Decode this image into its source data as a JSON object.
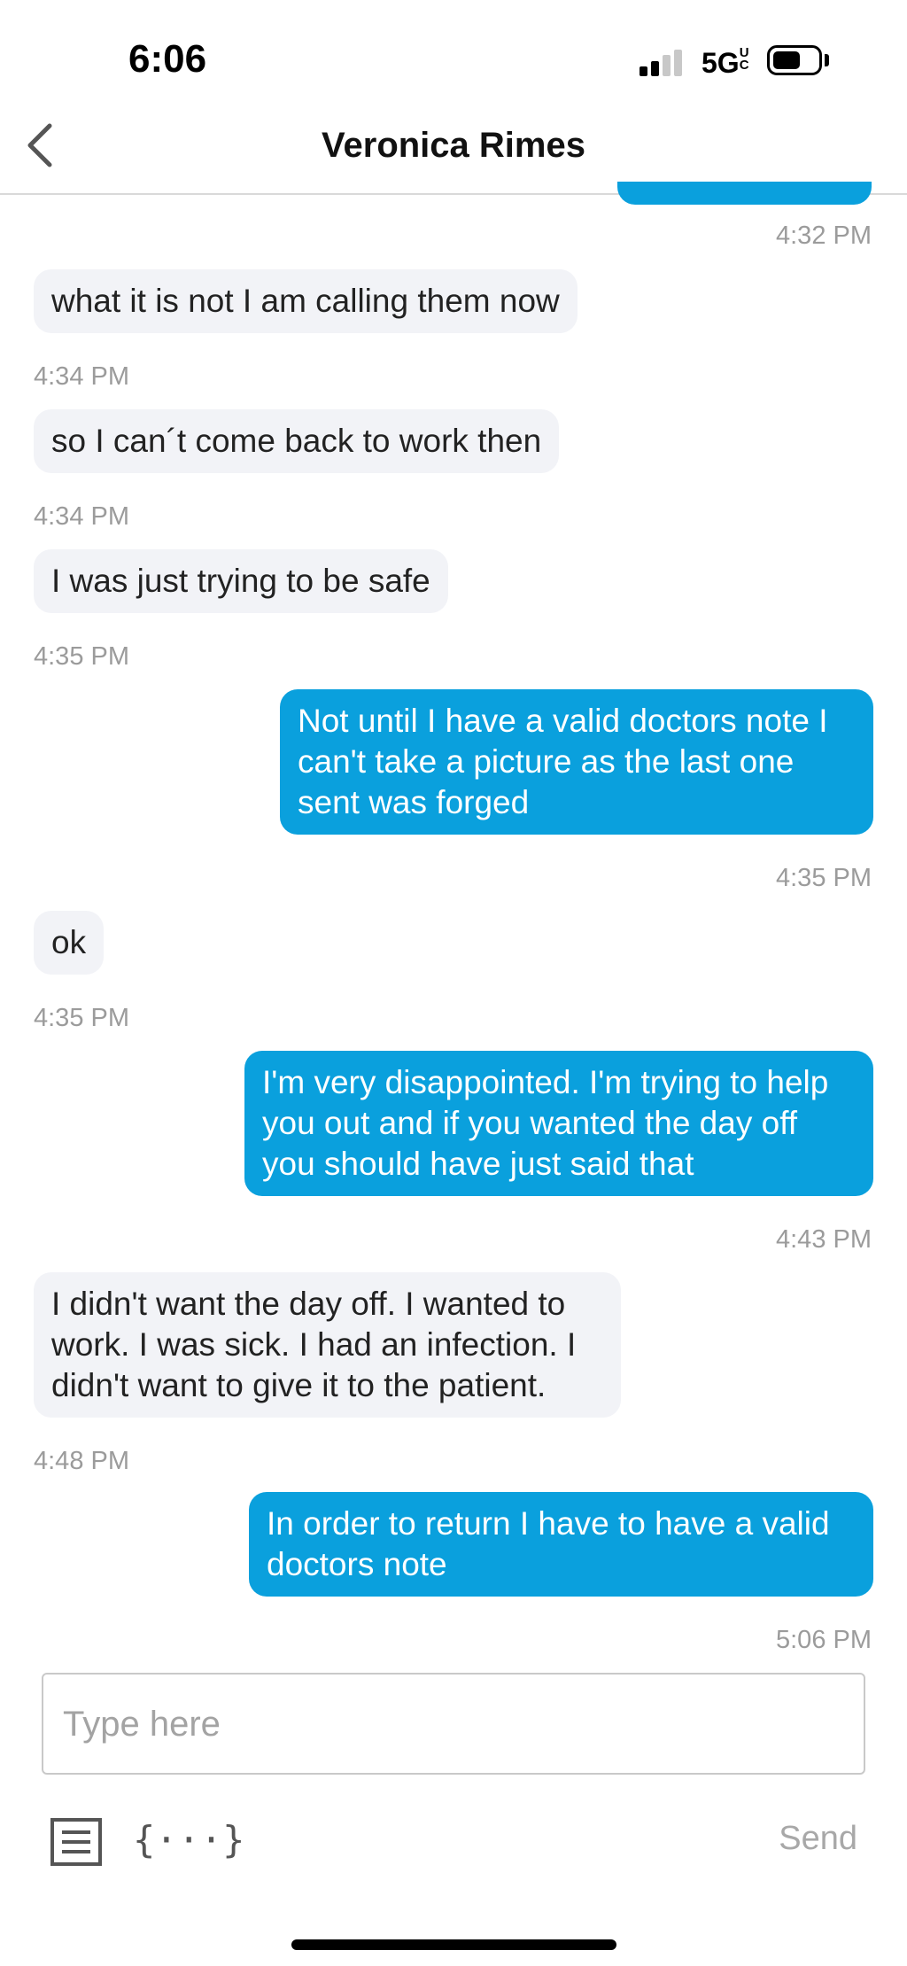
{
  "status_bar": {
    "time": "6:06",
    "network": "5G",
    "network_suffix": "UC",
    "icons": [
      "signal-icon",
      "battery-icon"
    ]
  },
  "header": {
    "back_icon": "chevron-left-icon",
    "contact_name": "Veronica Rimes"
  },
  "top_timestamp": "4:32 PM",
  "messages": [
    {
      "direction": "incoming",
      "text": "what it is not I am calling them now",
      "time": "4:34 PM"
    },
    {
      "direction": "incoming",
      "text": "so I can´t come back to work then",
      "time": "4:34 PM"
    },
    {
      "direction": "incoming",
      "text": "I was just trying to be safe",
      "time": "4:35 PM"
    },
    {
      "direction": "outgoing",
      "text": "Not until I have a valid doctors note I can't take a picture as the last one sent was forged",
      "time": "4:35 PM"
    },
    {
      "direction": "incoming",
      "text": "ok",
      "time": "4:35 PM"
    },
    {
      "direction": "outgoing",
      "text": "I'm very disappointed. I'm trying to help you out and if you wanted the day off you should have just said that",
      "time": "4:43 PM"
    },
    {
      "direction": "incoming",
      "text": "I didn't want the day off. I wanted to work. I was sick. I had an infection. I didn't want to give it to the patient.",
      "time": "4:48 PM"
    },
    {
      "direction": "outgoing",
      "text": "In order to return I have to have a valid doctors note",
      "time": "5:06 PM"
    }
  ],
  "composer": {
    "placeholder": "Type here",
    "value": "",
    "template_icon": "template-icon",
    "variable_icon": "variable-braces-icon",
    "variable_glyph": "{···}",
    "send_label": "Send"
  },
  "colors": {
    "outgoing_bubble": "#0aa0dd",
    "incoming_bubble": "#f2f3f7",
    "timestamp": "#9b9b9b",
    "send_disabled": "#a8a8a8"
  }
}
